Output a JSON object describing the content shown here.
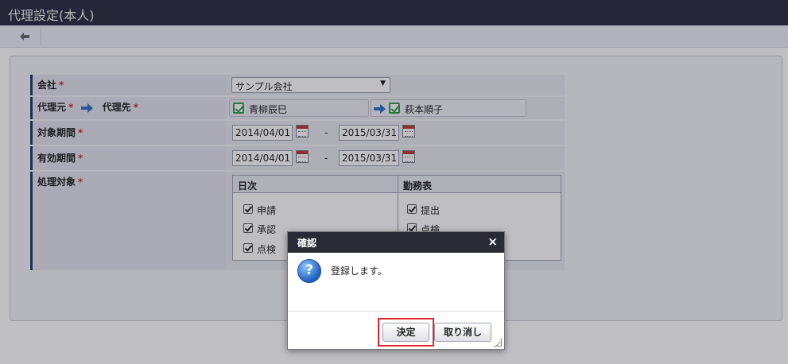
{
  "header": {
    "title": "代理設定(本人)"
  },
  "form": {
    "company": {
      "label": "会社",
      "value": "サンプル会社"
    },
    "delegation": {
      "from_label": "代理元",
      "to_label": "代理先",
      "from_person": "青柳辰巳",
      "to_person": "萩本順子"
    },
    "target_period": {
      "label": "対象期間",
      "start": "2014/04/01",
      "end": "2015/03/31",
      "separator": "-"
    },
    "valid_period": {
      "label": "有効期間",
      "start": "2014/04/01",
      "end": "2015/03/31",
      "separator": "-"
    },
    "process_target": {
      "label": "処理対象",
      "daily": {
        "header": "日次",
        "items": [
          "申請",
          "承認",
          "点検"
        ]
      },
      "work_sheet": {
        "header": "勤務表",
        "items": [
          "提出",
          "点検"
        ]
      }
    },
    "required_mark": "*"
  },
  "dialog": {
    "title": "確認",
    "close": "×",
    "message": "登録します。",
    "ok_label": "決定",
    "cancel_label": "取り消し"
  },
  "colors": {
    "accent_bar": "#2a3564",
    "required": "#d23030",
    "highlight": "#e0252b",
    "header_bg": "#2d2d3f"
  }
}
